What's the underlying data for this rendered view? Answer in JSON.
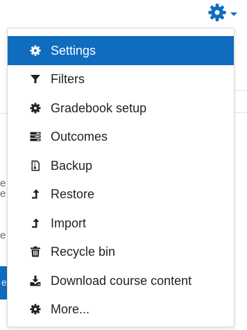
{
  "background": {
    "fragments": [
      "e",
      "e",
      "e"
    ],
    "button_fragment": "e"
  },
  "action_trigger": {
    "icon": "gear-icon",
    "caret_icon": "caret-down-icon",
    "accent_color": "#0f6cbf"
  },
  "menu": {
    "active_color": "#0f6cbf",
    "items": [
      {
        "label": "Settings",
        "icon": "gear-icon",
        "active": true
      },
      {
        "label": "Filters",
        "icon": "filter-icon",
        "active": false
      },
      {
        "label": "Gradebook setup",
        "icon": "gear-icon",
        "active": false
      },
      {
        "label": "Outcomes",
        "icon": "outcomes-icon",
        "active": false
      },
      {
        "label": "Backup",
        "icon": "file-archive-icon",
        "active": false
      },
      {
        "label": "Restore",
        "icon": "level-up-icon",
        "active": false
      },
      {
        "label": "Import",
        "icon": "level-up-icon",
        "active": false
      },
      {
        "label": "Recycle bin",
        "icon": "trash-icon",
        "active": false
      },
      {
        "label": "Download course content",
        "icon": "download-icon",
        "active": false
      },
      {
        "label": "More...",
        "icon": "gear-icon",
        "active": false
      }
    ]
  }
}
